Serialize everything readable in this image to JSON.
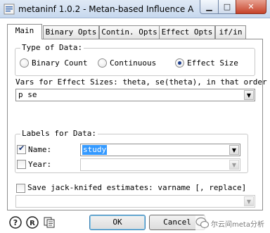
{
  "window": {
    "title": "metaninf 1.0.2 - Metan-based Influence A...",
    "minimize_label": "▁",
    "maximize_label": "□",
    "close_label": "✕"
  },
  "tabs": [
    {
      "label": "Main",
      "active": true
    },
    {
      "label": "Binary Opts",
      "active": false
    },
    {
      "label": "Contin. Opts",
      "active": false
    },
    {
      "label": "Effect Opts",
      "active": false
    },
    {
      "label": "if/in",
      "active": false
    }
  ],
  "type_of_data": {
    "group_label": "Type of Data:",
    "options": [
      {
        "label": "Binary Count",
        "checked": false
      },
      {
        "label": "Continuous",
        "checked": false
      },
      {
        "label": "Effect Size",
        "checked": true
      }
    ]
  },
  "vars_effect": {
    "label": "Vars for Effect Sizes: theta, se(theta), in that order",
    "value": "p se"
  },
  "labels_for_data": {
    "group_label": "Labels for Data:",
    "name": {
      "label": "Name:",
      "checked": true,
      "value": "study"
    },
    "year": {
      "label": "Year:",
      "checked": false,
      "value": ""
    }
  },
  "save_jackknife": {
    "label": "Save jack-knifed estimates: varname [, replace]",
    "checked": false,
    "value": ""
  },
  "buttons": {
    "ok": "OK",
    "cancel": "Cancel"
  },
  "icons": {
    "help": "help-icon",
    "reset": "reset-icon",
    "copy": "copy-icon"
  },
  "watermark": {
    "text": "尔云间meta分析"
  }
}
